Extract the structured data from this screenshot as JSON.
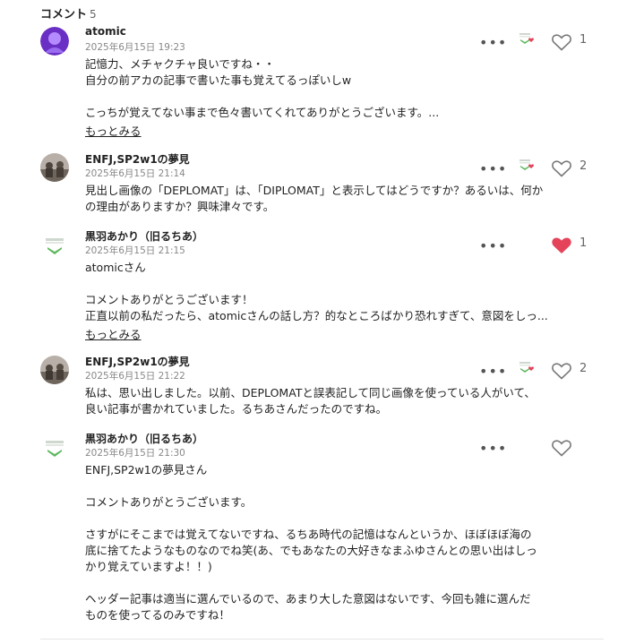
{
  "header": {
    "title": "コメント",
    "count": "5"
  },
  "colors": {
    "heart_active": "#e5435a",
    "heart_inactive": "#777777",
    "logo_green": "#5cb85c"
  },
  "comments": [
    {
      "author": "atomic",
      "time": "2025年6月15日 19:23",
      "avatar_icon": "avatar-purple-icon",
      "lines": [
        "記憶力、メチャクチャ良いですね・・",
        "自分の前アカの記事で書いた事も覚えてるっぽいしw",
        "",
        "こっちが覚えてない事まで色々書いてくれてありがとうございます。..."
      ],
      "more": "もっとみる",
      "likes": "1",
      "liked": false
    },
    {
      "author": "ENFJ,SP2w1の夢見",
      "time": "2025年6月15日 21:14",
      "avatar_icon": "avatar-photo-icon",
      "lines": [
        "見出し画像の「DEPLOMAT」は、「DIPLOMAT」と表示してはどうですか？あるいは、何か",
        "の理由がありますか？興味津々です。"
      ],
      "more": "",
      "likes": "2",
      "liked": false
    },
    {
      "author": "黒羽あかり（旧るちあ）",
      "time": "2025年6月15日 21:15",
      "avatar_icon": "avatar-logo-icon",
      "lines": [
        "atomicさん",
        "",
        "コメントありがとうございます！",
        "正直以前の私だったら、atomicさんの話し方？的なところばかり恐れすぎて、意図をしっ..."
      ],
      "more": "もっとみる",
      "likes": "1",
      "liked": true
    },
    {
      "author": "ENFJ,SP2w1の夢見",
      "time": "2025年6月15日 21:22",
      "avatar_icon": "avatar-photo-icon",
      "lines": [
        "私は、思い出しました。以前、DEPLOMATと誤表記して同じ画像を使っている人がいて、",
        "良い記事が書かれていました。るちあさんだったのですね。"
      ],
      "more": "",
      "likes": "2",
      "liked": false
    },
    {
      "author": "黒羽あかり（旧るちあ）",
      "time": "2025年6月15日 21:30",
      "avatar_icon": "avatar-logo-icon",
      "lines": [
        "ENFJ,SP2w1の夢見さん",
        "",
        "コメントありがとうございます。",
        "",
        "さすがにそこまでは覚えてないですね、るちあ時代の記憶はなんというか、ほぼほぼ海の",
        "底に捨てたようなものなのでね笑(あ、でもあなたの大好きなまふゆさんとの思い出はしっ",
        "かり覚えていますよ！！)",
        "",
        "ヘッダー記事は適当に選んでいるので、あまり大した意図はないです、今回も雑に選んだ",
        "ものを使ってるのみですね！"
      ],
      "more": "",
      "likes": "",
      "liked": false
    }
  ]
}
